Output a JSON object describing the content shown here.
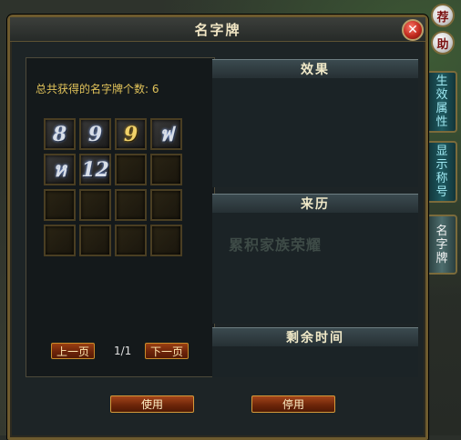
{
  "window": {
    "title": "名字牌",
    "close_symbol": "✕"
  },
  "left_panel": {
    "count_label": "总共获得的名字牌个数: 6",
    "cards": [
      {
        "glyph": "8",
        "tone": "silver"
      },
      {
        "glyph": "9",
        "tone": "silver"
      },
      {
        "glyph": "9",
        "tone": "gold"
      },
      {
        "glyph": "ฟ",
        "tone": "silver"
      },
      {
        "glyph": "ห",
        "tone": "silver"
      },
      {
        "glyph": "12",
        "tone": "silver"
      }
    ],
    "total_slots": 16,
    "pager": {
      "prev_label": "上一页",
      "page_text": "1/1",
      "next_label": "下一页"
    }
  },
  "right_panel": {
    "effect_header": "效果",
    "source_header": "来历",
    "source_text": "累积家族荣耀",
    "remaining_header": "剩余时间"
  },
  "actions": {
    "use_label": "使用",
    "disable_label": "停用"
  },
  "side_tabs": {
    "recommend": "荐",
    "help": "助",
    "attributes": "生效属性",
    "display": "显示称号",
    "nameplate": "名字牌"
  },
  "colors": {
    "accent_gold": "#e0c25a",
    "button_red": "#8a3410",
    "frame_border": "#6d5a2e"
  }
}
